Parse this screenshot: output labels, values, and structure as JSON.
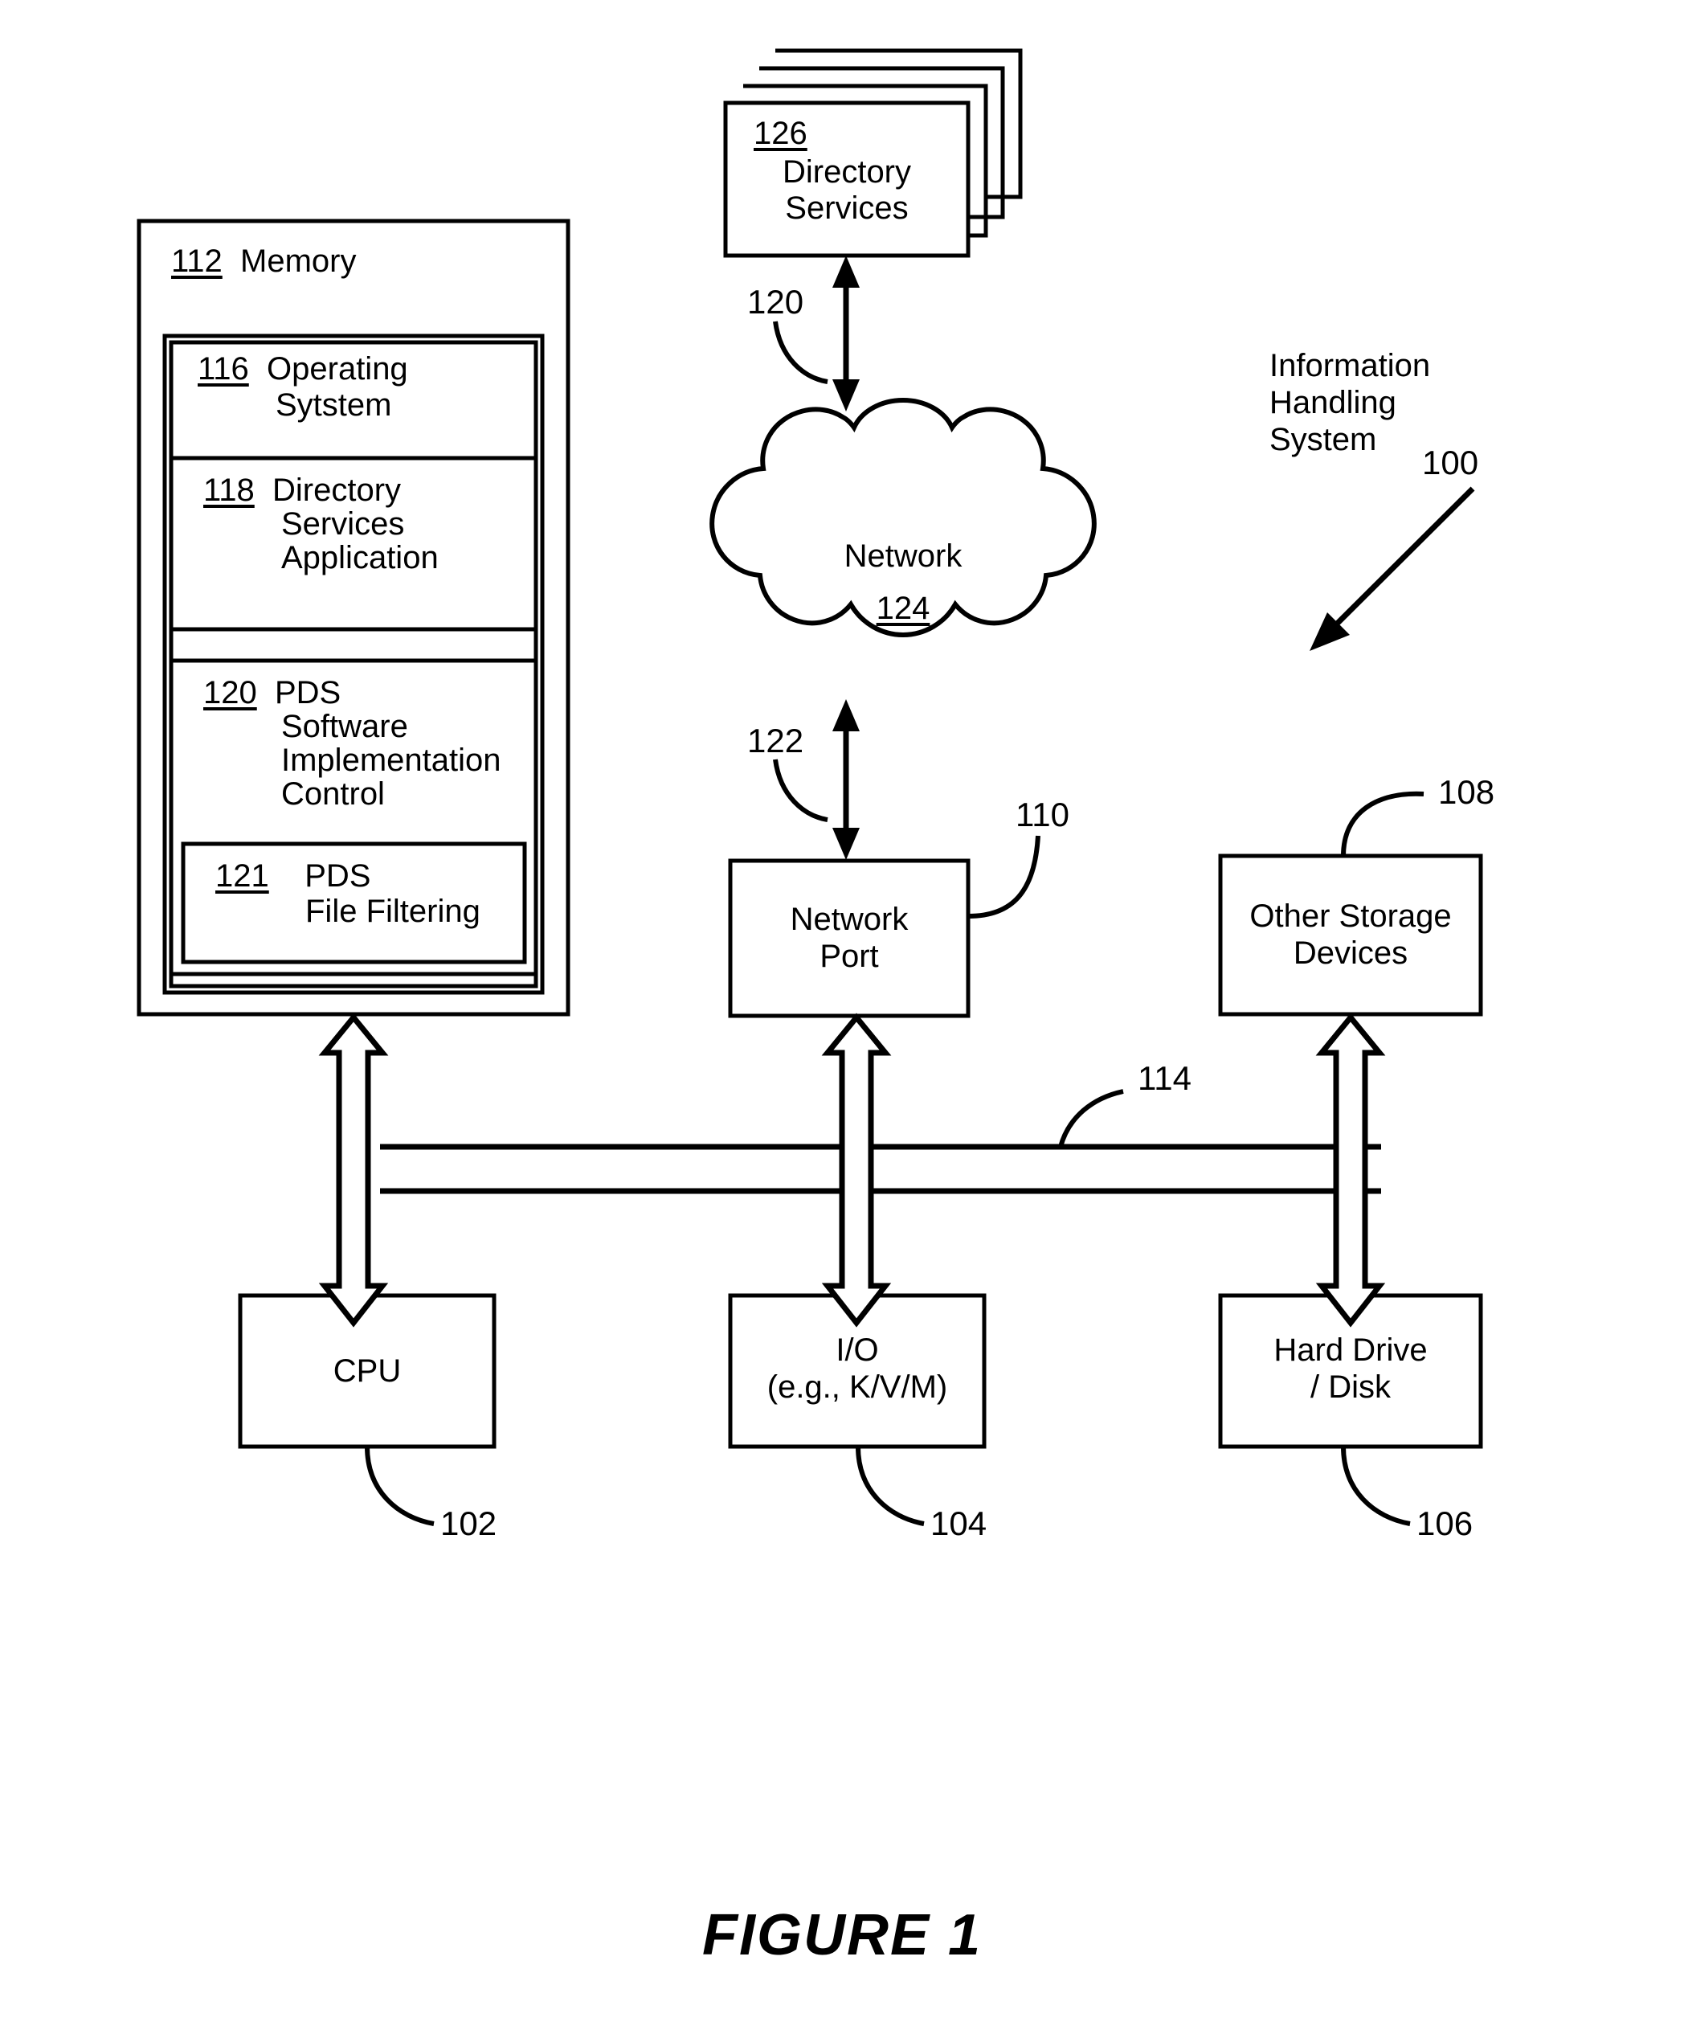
{
  "figure": {
    "caption": "FIGURE 1",
    "system_label_lines": [
      "Information",
      "Handling",
      "System"
    ],
    "system_ref": "100"
  },
  "memory": {
    "ref": "112",
    "title": "Memory",
    "operating_system": {
      "ref": "116",
      "lines": [
        "Operating",
        "Sytstem"
      ]
    },
    "directory_services_application": {
      "ref": "118",
      "lines": [
        "Directory",
        "Services",
        "Application"
      ]
    },
    "pds_control": {
      "ref": "120",
      "lines": [
        "PDS",
        "Software",
        "Implementation",
        "Control"
      ]
    },
    "pds_file_filtering": {
      "ref": "121",
      "lines": [
        "PDS",
        "File Filtering"
      ]
    }
  },
  "directory_services_stack": {
    "ref": "126",
    "lines": [
      "Directory",
      "Services"
    ],
    "sheet_count": 4
  },
  "network_cloud": {
    "title": "Network",
    "ref": "124"
  },
  "network_port": {
    "lines": [
      "Network",
      "Port"
    ],
    "ref": "110"
  },
  "other_storage": {
    "lines": [
      "Other Storage",
      "Devices"
    ],
    "ref": "108"
  },
  "cpu": {
    "lines": [
      "CPU"
    ],
    "ref": "102"
  },
  "io": {
    "lines": [
      "I/O",
      "(e.g., K/V/M)"
    ],
    "ref": "104"
  },
  "hard_drive": {
    "lines": [
      "Hard Drive",
      "/ Disk"
    ],
    "ref": "106"
  },
  "bus": {
    "ref": "114"
  },
  "links": {
    "ds_to_network_ref": "120",
    "network_to_port_ref": "122"
  },
  "colors": {
    "ink": "#000000",
    "paper": "#ffffff"
  }
}
